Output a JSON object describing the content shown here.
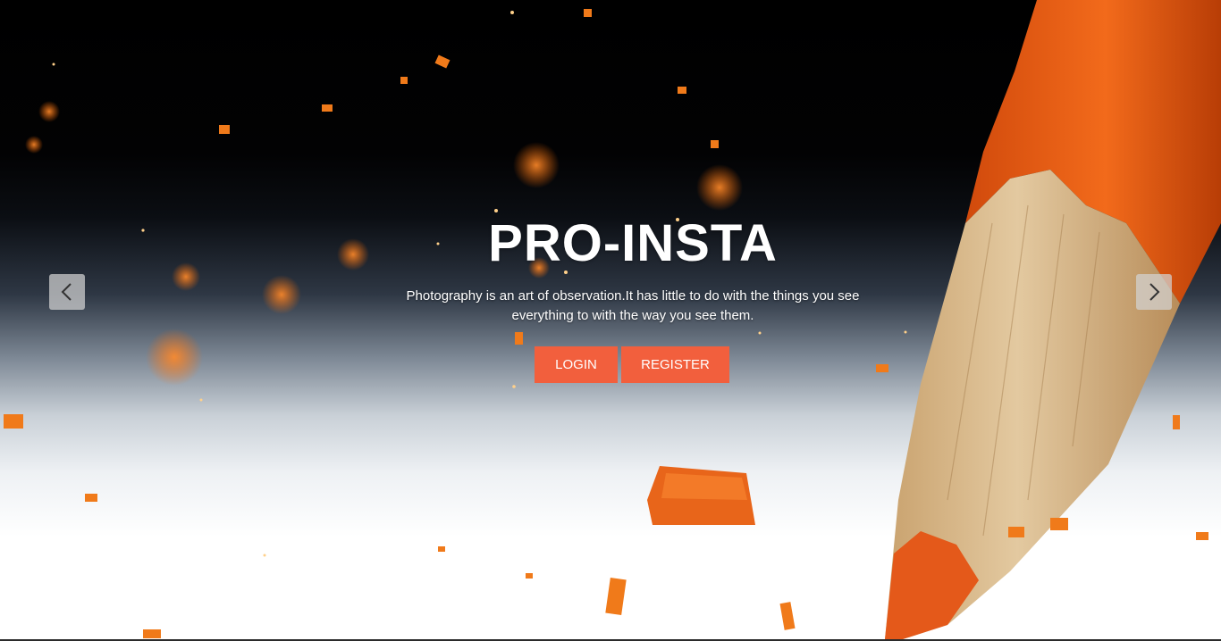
{
  "hero": {
    "title": "PRO-INSTA",
    "tagline_line1": "Photography is an art of observation.It has little to do with the things you see",
    "tagline_line2": "everything to with the way you see them.",
    "login_label": "LOGIN",
    "register_label": "REGISTER",
    "prev_icon": "chevron-left-icon",
    "next_icon": "chevron-right-icon"
  },
  "colors": {
    "button_bg": "#f25f3d",
    "button_text": "#ffffff",
    "title_text": "#ffffff",
    "pencil_orange": "#f0641c",
    "pencil_wood": "#d9b98c",
    "arrow_bg": "#d2d2d2"
  }
}
